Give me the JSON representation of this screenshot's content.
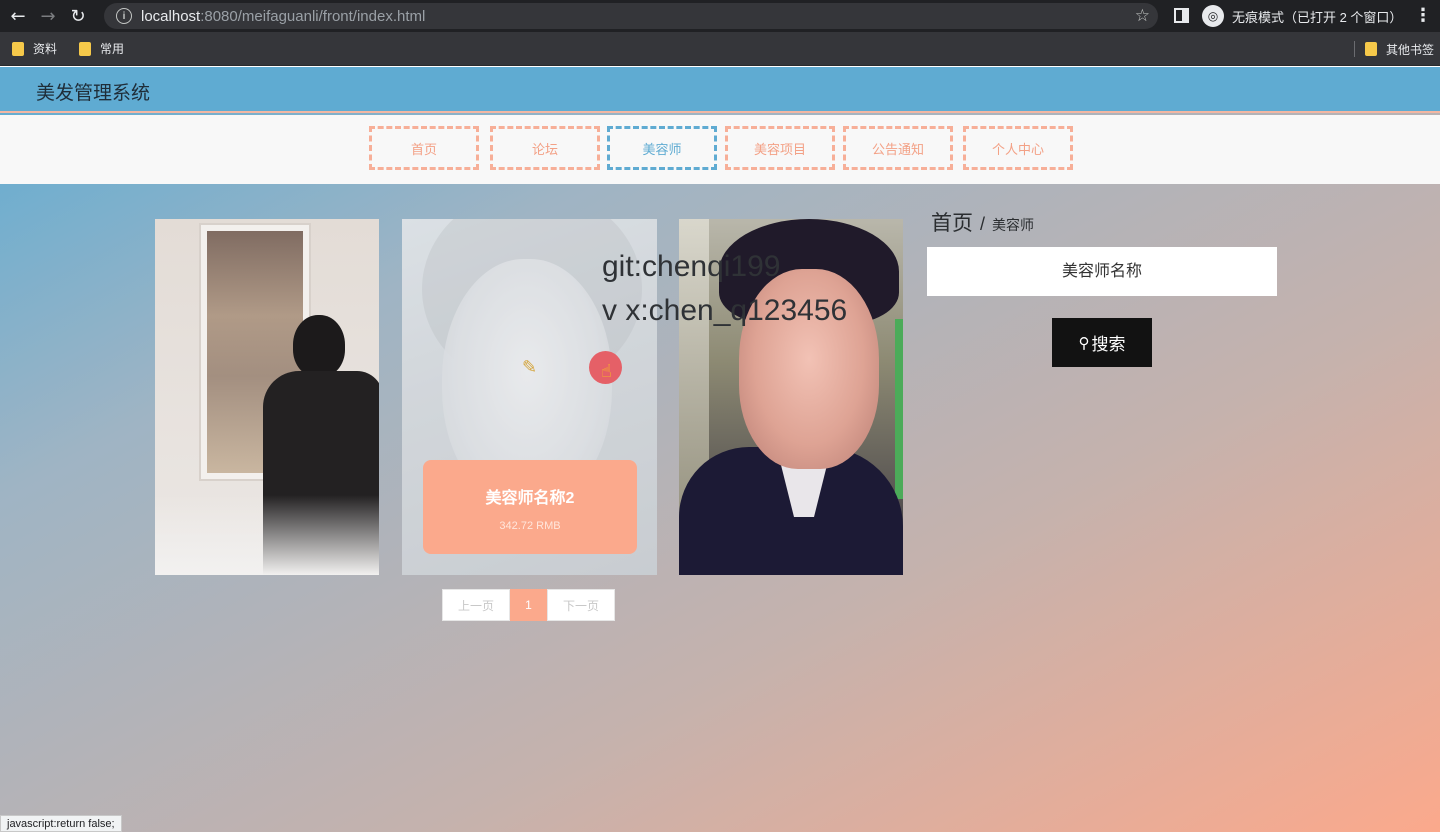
{
  "browser": {
    "url_host": "localhost",
    "url_rest": ":8080/meifaguanli/front/index.html",
    "incognito_label": "无痕模式（已打开 2 个窗口）",
    "bookmarks": [
      "资料",
      "常用"
    ],
    "other_bookmarks": "其他书签",
    "status": "javascript:return false;"
  },
  "site": {
    "title": "美发管理系统"
  },
  "nav": {
    "items": [
      {
        "label": "首页"
      },
      {
        "label": "论坛"
      },
      {
        "label": "美容师",
        "active": true
      },
      {
        "label": "美容项目"
      },
      {
        "label": "公告通知"
      },
      {
        "label": "个人中心"
      }
    ]
  },
  "cards": [
    {
      "name": "",
      "price": ""
    },
    {
      "name": "美容师名称2",
      "price": "342.72 RMB"
    },
    {
      "name": "",
      "price": ""
    }
  ],
  "watermark": {
    "line1": "git:chenqi199",
    "line2": "v x:chen_q123456"
  },
  "pagination": {
    "prev": "上一页",
    "current": "1",
    "next": "下一页"
  },
  "breadcrumb": {
    "home": "首页",
    "separator": "/",
    "current": "美容师"
  },
  "search": {
    "placeholder": "美容师名称",
    "button": "搜索"
  },
  "icons": {
    "back": "back-arrow-icon",
    "forward": "forward-arrow-icon",
    "reload": "reload-icon",
    "search": "magnifier-icon"
  },
  "colors": {
    "header": "#5fabd2",
    "accent": "#fba98c",
    "nav_text": "#f3a186"
  }
}
